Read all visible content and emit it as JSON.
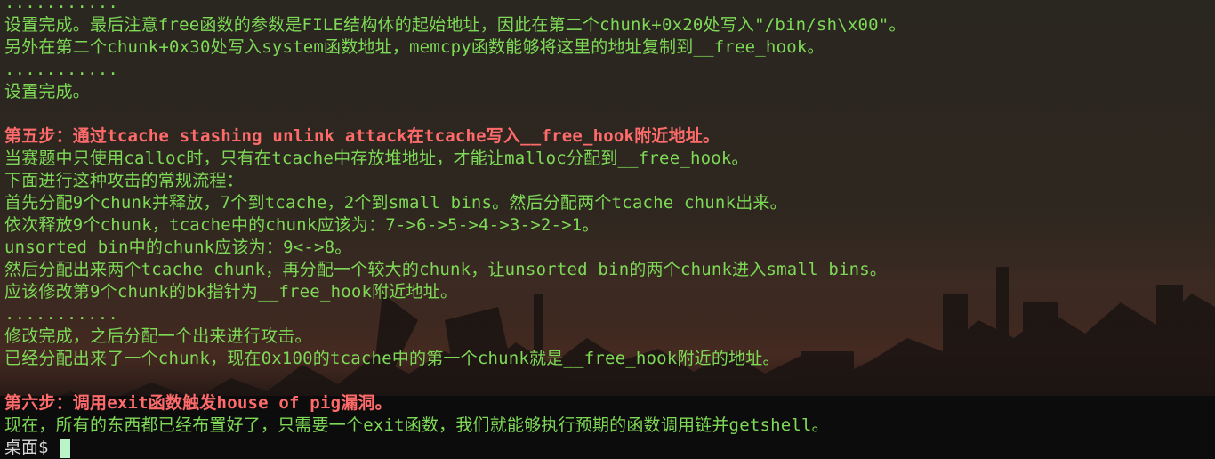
{
  "terminal": {
    "lines": [
      {
        "text": "...........",
        "style": "normal"
      },
      {
        "text": "设置完成。最后注意free函数的参数是FILE结构体的起始地址，因此在第二个chunk+0x20处写入\"/bin/sh\\x00\"。",
        "style": "normal"
      },
      {
        "text": "另外在第二个chunk+0x30处写入system函数地址，memcpy函数能够将这里的地址复制到__free_hook。",
        "style": "normal"
      },
      {
        "text": "...........",
        "style": "normal"
      },
      {
        "text": "设置完成。",
        "style": "normal"
      },
      {
        "text": "",
        "style": "blank"
      },
      {
        "text": "第五步：通过tcache stashing unlink attack在tcache写入__free_hook附近地址。",
        "style": "heading"
      },
      {
        "text": "当赛题中只使用calloc时，只有在tcache中存放堆地址，才能让malloc分配到__free_hook。",
        "style": "normal"
      },
      {
        "text": "下面进行这种攻击的常规流程：",
        "style": "normal"
      },
      {
        "text": "首先分配9个chunk并释放，7个到tcache，2个到small bins。然后分配两个tcache chunk出来。",
        "style": "normal"
      },
      {
        "text": "依次释放9个chunk，tcache中的chunk应该为：7->6->5->4->3->2->1。",
        "style": "normal"
      },
      {
        "text": "unsorted bin中的chunk应该为：9<->8。",
        "style": "normal"
      },
      {
        "text": "然后分配出来两个tcache chunk，再分配一个较大的chunk，让unsorted bin的两个chunk进入small bins。",
        "style": "normal"
      },
      {
        "text": "应该修改第9个chunk的bk指针为__free_hook附近地址。",
        "style": "normal"
      },
      {
        "text": "...........",
        "style": "normal"
      },
      {
        "text": "修改完成，之后分配一个出来进行攻击。",
        "style": "normal"
      },
      {
        "text": "已经分配出来了一个chunk，现在0x100的tcache中的第一个chunk就是__free_hook附近的地址。",
        "style": "normal"
      },
      {
        "text": "",
        "style": "blank"
      },
      {
        "text": "第六步：调用exit函数触发house of pig漏洞。",
        "style": "heading"
      },
      {
        "text": "现在，所有的东西都已经布置好了，只需要一个exit函数，我们就能够执行预期的函数调用链并getshell。",
        "style": "normal"
      }
    ],
    "prompt": "桌面$ ",
    "colors": {
      "output": "#7ed957",
      "heading": "#ff6b6b",
      "prompt": "#d9d9d9",
      "cursor": "#b9f5c9"
    }
  }
}
